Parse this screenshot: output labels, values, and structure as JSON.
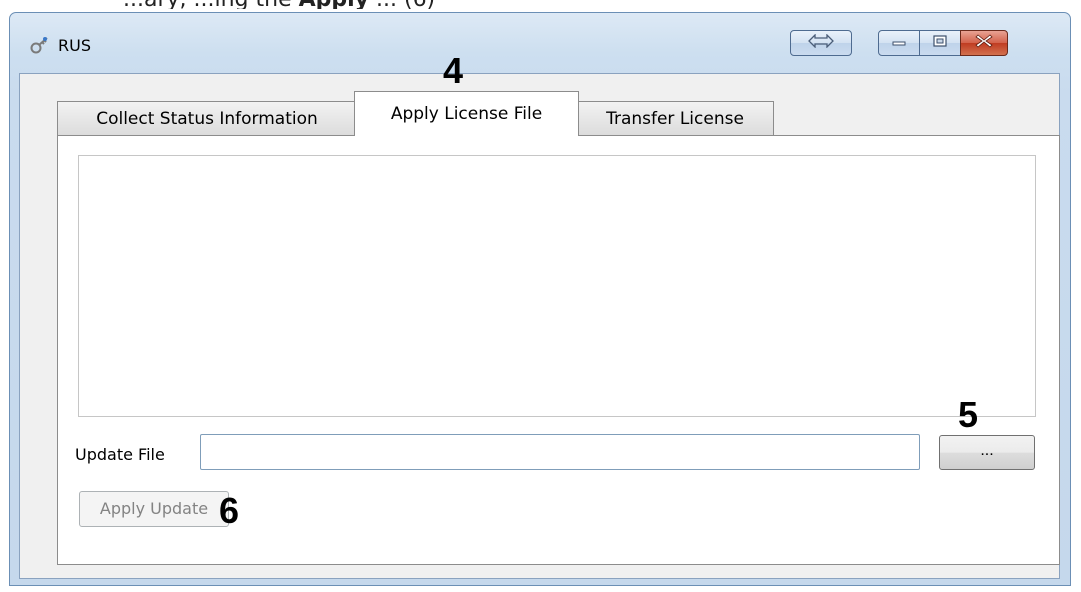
{
  "caption": {
    "prefix": "_",
    "text": "...ary, ...ing the ",
    "bold": "Apply",
    "suffix": " ... (6)"
  },
  "window": {
    "title": "RUS",
    "app_icon": "key-icon"
  },
  "titlebar_buttons": {
    "swap": "swap-icon",
    "minimize": "minimize-icon",
    "maximize": "maximize-icon",
    "close": "close-icon"
  },
  "tabs": [
    {
      "label": "Collect Status Information",
      "active": false
    },
    {
      "label": "Apply License File",
      "active": true
    },
    {
      "label": "Transfer License",
      "active": false
    }
  ],
  "form": {
    "update_file_label": "Update File",
    "update_file_value": "",
    "browse_label": "...",
    "apply_label": "Apply Update",
    "apply_enabled": false
  },
  "callouts": {
    "tab": "4",
    "browse": "5",
    "apply": "6"
  },
  "colors": {
    "title_bar": "#cddff0",
    "close_button": "#c03c22",
    "disabled_text": "#838383"
  }
}
